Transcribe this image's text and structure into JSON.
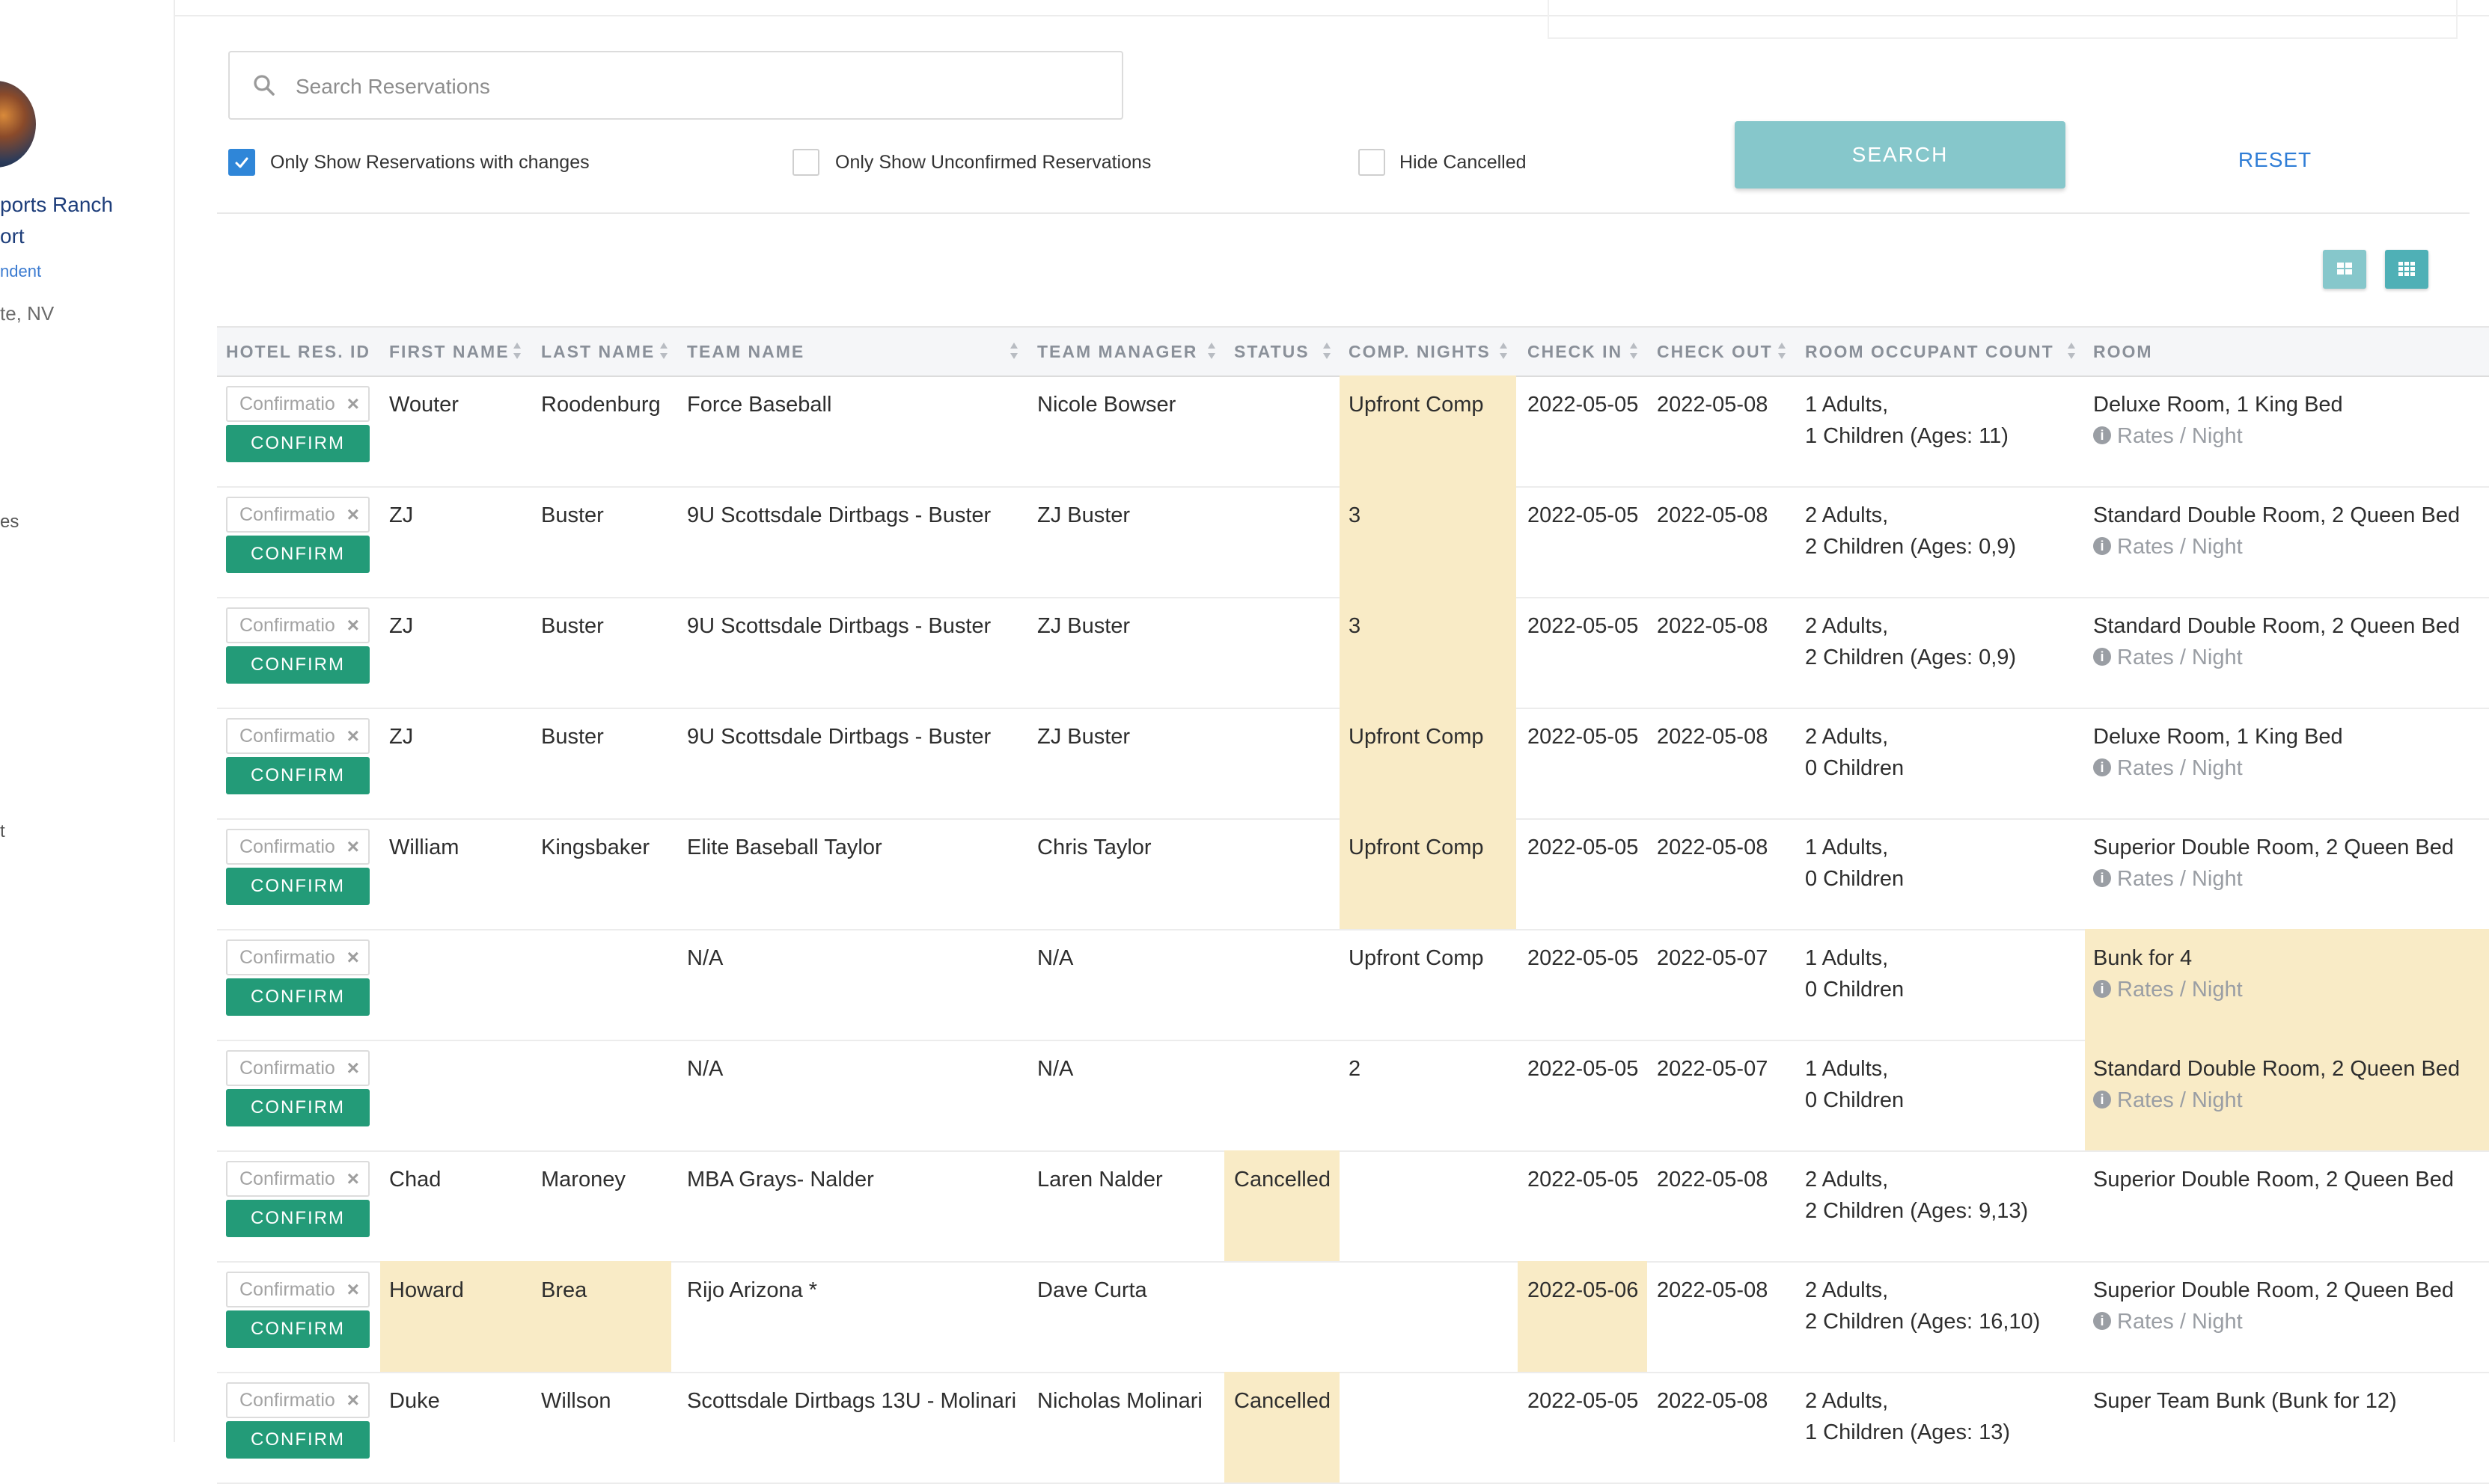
{
  "sidebar": {
    "name_line1": "ports Ranch",
    "name_line2": "ort",
    "role": "ndent",
    "location": "te, NV",
    "nav_item_1": "es",
    "nav_item_2": "t"
  },
  "search": {
    "placeholder": "Search Reservations",
    "value": ""
  },
  "filters": {
    "only_changes": {
      "label": "Only Show Reservations with changes",
      "checked": true
    },
    "only_unconfirmed": {
      "label": "Only Show Unconfirmed Reservations",
      "checked": false
    },
    "hide_cancelled": {
      "label": "Hide Cancelled",
      "checked": false
    }
  },
  "buttons": {
    "search": "SEARCH",
    "reset": "RESET"
  },
  "colors": {
    "accent_teal": "#86c7cb",
    "confirm_green": "#239b78",
    "highlight": "#f9ebc6",
    "link_blue": "#2f7dd6",
    "checkbox_blue": "#2f86d8"
  },
  "view_toggle_icons": [
    "grid-large-icon",
    "grid-small-icon"
  ],
  "table": {
    "columns": [
      "HOTEL RES. ID",
      "FIRST NAME",
      "LAST NAME",
      "TEAM NAME",
      "TEAM MANAGER",
      "STATUS",
      "COMP. NIGHTS",
      "CHECK IN",
      "CHECK OUT",
      "ROOM OCCUPANT COUNT",
      "ROOM"
    ],
    "confirmation_placeholder": "Confirmation",
    "confirm_label": "CONFIRM",
    "rates_label": "Rates / Night",
    "rows": [
      {
        "first": "Wouter",
        "last": "Roodenburg",
        "team": "Force Baseball",
        "manager": "Nicole Bowser",
        "status": "",
        "comp": "Upfront Comp",
        "checkin": "2022-05-05",
        "checkout": "2022-05-08",
        "occ1": "1 Adults,",
        "occ2": "1 Children (Ages: 11)",
        "room": "Deluxe Room, 1 King Bed",
        "rates": true,
        "hl": [
          "comp"
        ]
      },
      {
        "first": "ZJ",
        "last": "Buster",
        "team": "9U Scottsdale Dirtbags - Buster",
        "manager": "ZJ Buster",
        "status": "",
        "comp": "3",
        "checkin": "2022-05-05",
        "checkout": "2022-05-08",
        "occ1": "2 Adults,",
        "occ2": "2 Children (Ages: 0,9)",
        "room": "Standard Double Room, 2 Queen Bed",
        "rates": true,
        "hl": [
          "comp"
        ]
      },
      {
        "first": "ZJ",
        "last": "Buster",
        "team": "9U Scottsdale Dirtbags - Buster",
        "manager": "ZJ Buster",
        "status": "",
        "comp": "3",
        "checkin": "2022-05-05",
        "checkout": "2022-05-08",
        "occ1": "2 Adults,",
        "occ2": "2 Children (Ages: 0,9)",
        "room": "Standard Double Room, 2 Queen Bed",
        "rates": true,
        "hl": [
          "comp"
        ]
      },
      {
        "first": "ZJ",
        "last": "Buster",
        "team": "9U Scottsdale Dirtbags - Buster",
        "manager": "ZJ Buster",
        "status": "",
        "comp": "Upfront Comp",
        "checkin": "2022-05-05",
        "checkout": "2022-05-08",
        "occ1": "2 Adults,",
        "occ2": "0 Children",
        "room": "Deluxe Room, 1 King Bed",
        "rates": true,
        "hl": [
          "comp"
        ]
      },
      {
        "first": "William",
        "last": "Kingsbaker",
        "team": "Elite Baseball Taylor",
        "manager": "Chris Taylor",
        "status": "",
        "comp": "Upfront Comp",
        "checkin": "2022-05-05",
        "checkout": "2022-05-08",
        "occ1": "1 Adults,",
        "occ2": "0 Children",
        "room": "Superior Double Room, 2 Queen Bed",
        "rates": true,
        "hl": [
          "comp"
        ]
      },
      {
        "first": "",
        "last": "",
        "team": "N/A",
        "manager": "N/A",
        "status": "",
        "comp": "Upfront Comp",
        "checkin": "2022-05-05",
        "checkout": "2022-05-07",
        "occ1": "1 Adults,",
        "occ2": "0 Children",
        "room": "Bunk for 4",
        "rates": true,
        "hl": [
          "room"
        ]
      },
      {
        "first": "",
        "last": "",
        "team": "N/A",
        "manager": "N/A",
        "status": "",
        "comp": "2",
        "checkin": "2022-05-05",
        "checkout": "2022-05-07",
        "occ1": "1 Adults,",
        "occ2": "0 Children",
        "room": "Standard Double Room, 2 Queen Bed",
        "rates": true,
        "hl": [
          "room"
        ]
      },
      {
        "first": "Chad",
        "last": "Maroney",
        "team": "MBA Grays- Nalder",
        "manager": "Laren Nalder",
        "status": "Cancelled",
        "comp": "",
        "checkin": "2022-05-05",
        "checkout": "2022-05-08",
        "occ1": "2 Adults,",
        "occ2": "2 Children (Ages: 9,13)",
        "room": "Superior Double Room, 2 Queen Bed",
        "rates": false,
        "hl": [
          "status"
        ]
      },
      {
        "first": "Howard",
        "last": "Brea",
        "team": "Rijo Arizona *",
        "manager": "Dave Curta",
        "status": "",
        "comp": "",
        "checkin": "2022-05-06",
        "checkout": "2022-05-08",
        "occ1": "2 Adults,",
        "occ2": "2 Children (Ages: 16,10)",
        "room": "Superior Double Room, 2 Queen Bed",
        "rates": true,
        "hl": [
          "first",
          "last",
          "checkin"
        ]
      },
      {
        "first": "Duke",
        "last": "Willson",
        "team": "Scottsdale Dirtbags 13U - Molinari",
        "manager": "Nicholas Molinari",
        "status": "Cancelled",
        "comp": "",
        "checkin": "2022-05-05",
        "checkout": "2022-05-08",
        "occ1": "2 Adults,",
        "occ2": "1 Children (Ages: 13)",
        "room": "Super Team Bunk (Bunk for 12)",
        "rates": false,
        "hl": [
          "status"
        ]
      }
    ]
  }
}
